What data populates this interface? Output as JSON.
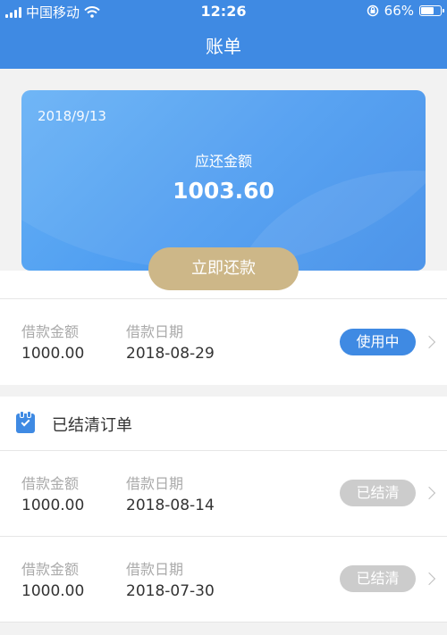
{
  "status_bar": {
    "carrier": "中国移动",
    "time": "12:26",
    "battery_percent": "66%",
    "battery_level": 0.66
  },
  "nav": {
    "title": "账单"
  },
  "card": {
    "date": "2018/9/13",
    "amount_label": "应还金额",
    "amount": "1003.60"
  },
  "repay_button": "立即还款",
  "active_loan": {
    "amount_label": "借款金额",
    "amount": "1000.00",
    "date_label": "借款日期",
    "date": "2018-08-29",
    "status": "使用中"
  },
  "settled_section": {
    "title": "已结清订单"
  },
  "settled_orders": [
    {
      "amount_label": "借款金额",
      "amount": "1000.00",
      "date_label": "借款日期",
      "date": "2018-08-14",
      "status": "已结清"
    },
    {
      "amount_label": "借款金额",
      "amount": "1000.00",
      "date_label": "借款日期",
      "date": "2018-07-30",
      "status": "已结清"
    }
  ],
  "colors": {
    "primary_blue": "#3f8ae3",
    "gold_button": "#cdb788",
    "settled_gray": "#cccccc"
  },
  "icons": [
    "signal-icon",
    "wifi-icon",
    "rotation-lock-icon",
    "battery-icon",
    "calendar-check-icon",
    "chevron-right-icon"
  ]
}
